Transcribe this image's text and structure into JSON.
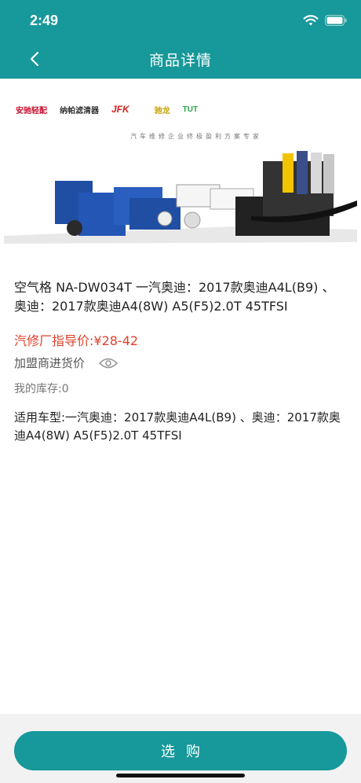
{
  "status_bar": {
    "time": "2:49"
  },
  "nav": {
    "title": "商品详情"
  },
  "banner": {
    "brands": [
      "安驰轻配",
      "纳帕滤清器",
      "JFK",
      "",
      "驰龙",
      "TUT"
    ],
    "tagline": "汽车维修企业终极盈利方案专家"
  },
  "product": {
    "name": "空气格 NA-DW034T 一汽奥迪：2017款奥迪A4L(B9) 、奥迪：2017款奥迪A4(8W) A5(F5)2.0T 45TFSI",
    "price_guide": "汽修厂指导价:¥28-42",
    "dealer_price_label": "加盟商进货价",
    "stock": "我的库存:0",
    "fitment": "适用车型:一汽奥迪：2017款奥迪A4L(B9) 、奥迪：2017款奥迪A4(8W) A5(F5)2.0T 45TFSI"
  },
  "actions": {
    "buy_label": "选购"
  },
  "colors": {
    "primary": "#17989a",
    "price": "#e0402a"
  }
}
